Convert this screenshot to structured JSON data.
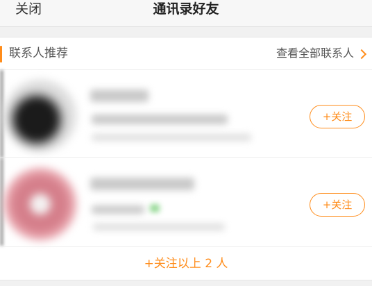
{
  "nav": {
    "close_label": "关闭",
    "title": "通讯录好友"
  },
  "section": {
    "title": "联系人推荐",
    "view_all_label": "查看全部联系人"
  },
  "rows": [
    {
      "follow_label": "+关注"
    },
    {
      "follow_label": "+关注"
    }
  ],
  "footer": {
    "follow_all_label": "+关注以上 2 人"
  },
  "colors": {
    "accent": "#ff8c1a",
    "background": "#f1f1f1"
  },
  "icons": {
    "view_all": "chevron-right-icon"
  }
}
